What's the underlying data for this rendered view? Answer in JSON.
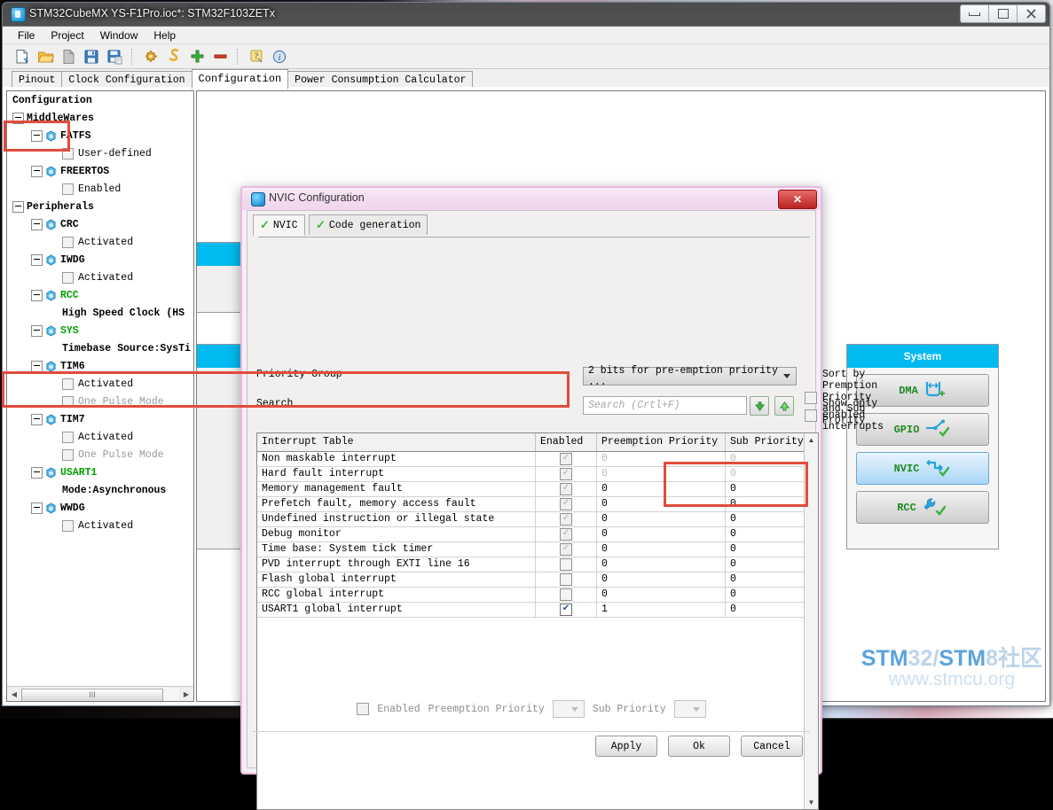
{
  "window": {
    "title": "STM32CubeMX YS-F1Pro.ioc*: STM32F103ZETx",
    "minimize": "–",
    "maximize": "□",
    "close": "✖"
  },
  "menu": [
    "File",
    "Project",
    "Window",
    "Help"
  ],
  "toolbar": [
    {
      "name": "new-project-icon",
      "tip": "New Project"
    },
    {
      "name": "open-project-icon",
      "tip": "Load Project"
    },
    {
      "name": "import-project-icon",
      "tip": "Import Project"
    },
    {
      "name": "save-project-icon",
      "tip": "Save Project"
    },
    {
      "name": "save-project-as-icon",
      "tip": "Save Project As"
    },
    {
      "name": "generate-code-icon",
      "tip": "Generate Code"
    },
    {
      "name": "generate-report-icon",
      "tip": "Generate Report"
    },
    {
      "name": "zoom-in-icon",
      "tip": "Zoom In"
    },
    {
      "name": "zoom-out-icon",
      "tip": "Zoom Out"
    },
    {
      "name": "help-icon",
      "tip": "Help"
    },
    {
      "name": "about-icon",
      "tip": "About"
    }
  ],
  "tabs": [
    {
      "label": "Pinout",
      "active": false
    },
    {
      "label": "Clock Configuration",
      "active": false
    },
    {
      "label": "Configuration",
      "active": true
    },
    {
      "label": "Power Consumption Calculator",
      "active": false
    }
  ],
  "sidebar": {
    "root": "Configuration",
    "hscroll_thumb": "III",
    "nodes": [
      {
        "label": "MiddleWares",
        "depth": 0,
        "type": "group",
        "style": "bold"
      },
      {
        "label": "FATFS",
        "depth": 1,
        "type": "peripheral",
        "style": "bold"
      },
      {
        "label": "User-defined",
        "depth": 2,
        "type": "checkbox",
        "checked": false,
        "style": "normal"
      },
      {
        "label": "FREERTOS",
        "depth": 1,
        "type": "peripheral",
        "style": "bold"
      },
      {
        "label": "Enabled",
        "depth": 2,
        "type": "checkbox",
        "checked": false,
        "style": "normal"
      },
      {
        "label": "Peripherals",
        "depth": 0,
        "type": "group",
        "style": "bold"
      },
      {
        "label": "CRC",
        "depth": 1,
        "type": "peripheral",
        "style": "bold"
      },
      {
        "label": "Activated",
        "depth": 2,
        "type": "checkbox",
        "checked": false,
        "style": "normal"
      },
      {
        "label": "IWDG",
        "depth": 1,
        "type": "peripheral",
        "style": "bold"
      },
      {
        "label": "Activated",
        "depth": 2,
        "type": "checkbox",
        "checked": false,
        "style": "normal"
      },
      {
        "label": "RCC",
        "depth": 1,
        "type": "peripheral",
        "style": "green"
      },
      {
        "label": "High Speed Clock (HS",
        "depth": 2,
        "type": "text",
        "style": "bold"
      },
      {
        "label": "SYS",
        "depth": 1,
        "type": "peripheral",
        "style": "green"
      },
      {
        "label": "Timebase Source:SysTi",
        "depth": 2,
        "type": "text",
        "style": "bold"
      },
      {
        "label": "TIM6",
        "depth": 1,
        "type": "peripheral",
        "style": "bold"
      },
      {
        "label": "Activated",
        "depth": 2,
        "type": "checkbox",
        "checked": false,
        "style": "normal"
      },
      {
        "label": "One Pulse Mode",
        "depth": 2,
        "type": "checkbox",
        "checked": false,
        "style": "disabled"
      },
      {
        "label": "TIM7",
        "depth": 1,
        "type": "peripheral",
        "style": "bold"
      },
      {
        "label": "Activated",
        "depth": 2,
        "type": "checkbox",
        "checked": false,
        "style": "normal"
      },
      {
        "label": "One Pulse Mode",
        "depth": 2,
        "type": "checkbox",
        "checked": false,
        "style": "disabled"
      },
      {
        "label": "USART1",
        "depth": 1,
        "type": "peripheral",
        "style": "green"
      },
      {
        "label": "Mode:Asynchronous",
        "depth": 2,
        "type": "text",
        "style": "bold"
      },
      {
        "label": "WWDG",
        "depth": 1,
        "type": "peripheral",
        "style": "bold"
      },
      {
        "label": "Activated",
        "depth": 2,
        "type": "checkbox",
        "checked": false,
        "style": "normal"
      }
    ]
  },
  "system_panel": {
    "title": "System",
    "buttons": [
      {
        "label": "DMA",
        "icon": "dma-icon",
        "state": "normal"
      },
      {
        "label": "GPIO",
        "icon": "gpio-icon",
        "state": "configured"
      },
      {
        "label": "NVIC",
        "icon": "nvic-icon",
        "state": "selected"
      },
      {
        "label": "RCC",
        "icon": "rcc-wrench-icon",
        "state": "configured"
      }
    ]
  },
  "dialog": {
    "title": "NVIC Configuration",
    "tabs": [
      {
        "label": "NVIC",
        "active": true,
        "icon": "green-check-icon"
      },
      {
        "label": "Code generation",
        "active": false,
        "icon": "green-check-icon"
      }
    ],
    "priority_group_label": "Priority Group",
    "priority_group_value": "2 bits for pre-emption priority ...",
    "search_label": "Search",
    "search_placeholder": "Search (Crtl+F)",
    "search_value": "",
    "sort_checkbox_label": "Sort by Premption Priority and Sub Prority",
    "sort_checked": false,
    "show_enabled_label": "Show only enabled interrupts",
    "show_enabled_checked": false,
    "columns": [
      "Interrupt Table",
      "Enabled",
      "Preemption Priority",
      "Sub Priority"
    ],
    "rows": [
      {
        "name": "Non maskable interrupt",
        "enabled": true,
        "readonly": true,
        "preemption": "0",
        "sub": "0",
        "dim": true
      },
      {
        "name": "Hard fault interrupt",
        "enabled": true,
        "readonly": true,
        "preemption": "0",
        "sub": "0",
        "dim": true
      },
      {
        "name": "Memory management fault",
        "enabled": true,
        "readonly": true,
        "preemption": "0",
        "sub": "0",
        "dim": false
      },
      {
        "name": "Prefetch fault, memory access fault",
        "enabled": true,
        "readonly": true,
        "preemption": "0",
        "sub": "0",
        "dim": false
      },
      {
        "name": "Undefined instruction or illegal state",
        "enabled": true,
        "readonly": true,
        "preemption": "0",
        "sub": "0",
        "dim": false
      },
      {
        "name": "Debug monitor",
        "enabled": true,
        "readonly": true,
        "preemption": "0",
        "sub": "0",
        "dim": false
      },
      {
        "name": "Time base: System tick timer",
        "enabled": true,
        "readonly": true,
        "preemption": "0",
        "sub": "0",
        "dim": false
      },
      {
        "name": "PVD interrupt through EXTI line 16",
        "enabled": false,
        "readonly": false,
        "preemption": "0",
        "sub": "0",
        "dim": false
      },
      {
        "name": "Flash global interrupt",
        "enabled": false,
        "readonly": false,
        "preemption": "0",
        "sub": "0",
        "dim": false
      },
      {
        "name": "RCC global interrupt",
        "enabled": false,
        "readonly": false,
        "preemption": "0",
        "sub": "0",
        "dim": false
      },
      {
        "name": "USART1 global interrupt",
        "enabled": true,
        "readonly": false,
        "preemption": "1",
        "sub": "0",
        "dim": false
      }
    ],
    "footer": {
      "enabled_label": "Enabled",
      "enabled_checked": false,
      "preemption_label": "Preemption Priority",
      "preemption_value": "",
      "sub_label": "Sub Priority",
      "sub_value": ""
    },
    "buttons": [
      {
        "label": "Apply",
        "name": "apply-button"
      },
      {
        "label": "Ok",
        "name": "ok-button"
      },
      {
        "label": "Cancel",
        "name": "cancel-button"
      }
    ]
  },
  "watermark": {
    "line1_a": "STM",
    "line1_b": "32/",
    "line1_c": "STM",
    "line1_d": "8社区",
    "line2": "www.stmcu.org"
  },
  "colors": {
    "accent_cyan": "#00baf0",
    "annotation_red": "#e24b3b",
    "green_label": "#1f8a1f",
    "dialog_pink": "#e8b9e0"
  }
}
